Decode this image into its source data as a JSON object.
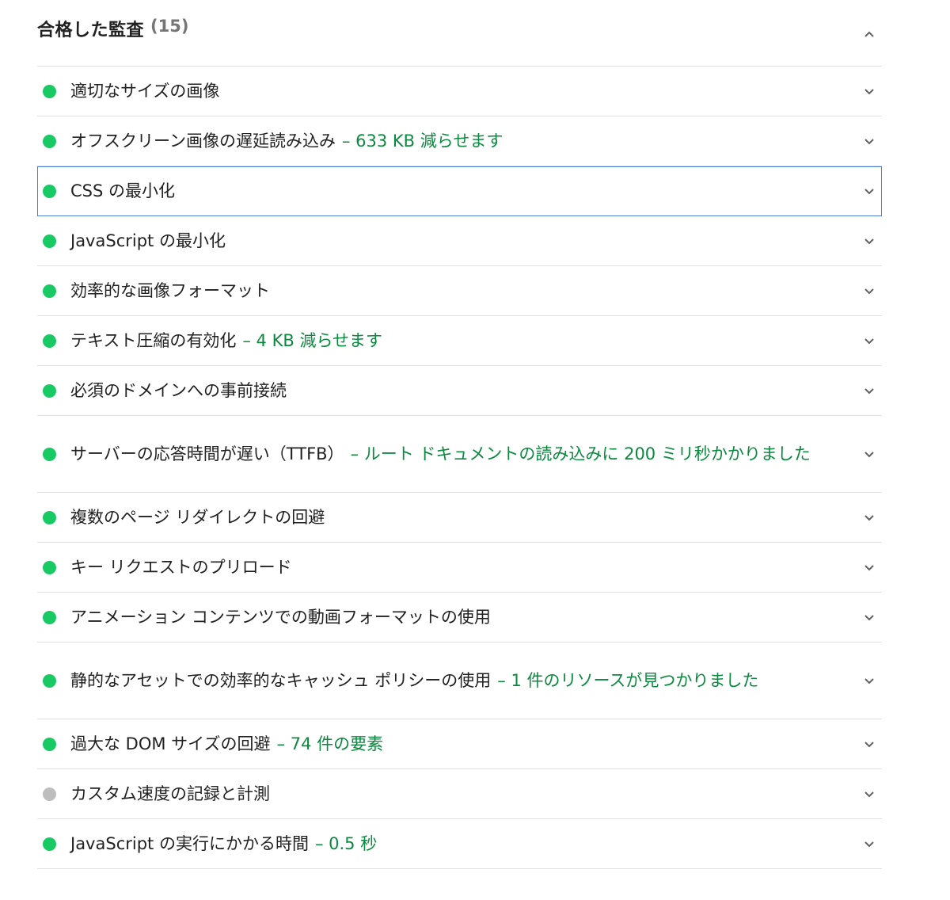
{
  "group": {
    "title": "合格した監査",
    "count": "(15)"
  },
  "colors": {
    "pass": "#18c964",
    "informative": "#bdbdbd",
    "display_value": "#0b8a3f",
    "focus_outline": "#4a7fd4"
  },
  "audits": [
    {
      "title": "適切なサイズの画像",
      "display": "",
      "status": "pass"
    },
    {
      "title": "オフスクリーン画像の遅延読み込み",
      "display": "– 633 KB 減らせます",
      "status": "pass"
    },
    {
      "title": "CSS の最小化",
      "display": "",
      "status": "pass"
    },
    {
      "title": "JavaScript の最小化",
      "display": "",
      "status": "pass"
    },
    {
      "title": "効率的な画像フォーマット",
      "display": "",
      "status": "pass"
    },
    {
      "title": "テキスト圧縮の有効化",
      "display": "– 4 KB 減らせます",
      "status": "pass"
    },
    {
      "title": "必須のドメインへの事前接続",
      "display": "",
      "status": "pass"
    },
    {
      "title": "サーバーの応答時間が遅い（TTFB）",
      "display": "– ルート ドキュメントの読み込みに 200 ミリ秒かかりました",
      "status": "pass"
    },
    {
      "title": "複数のページ リダイレクトの回避",
      "display": "",
      "status": "pass"
    },
    {
      "title": "キー リクエストのプリロード",
      "display": "",
      "status": "pass"
    },
    {
      "title": "アニメーション コンテンツでの動画フォーマットの使用",
      "display": "",
      "status": "pass"
    },
    {
      "title": "静的なアセットでの効率的なキャッシュ ポリシーの使用",
      "display": "– 1 件のリソースが見つかりました",
      "status": "pass"
    },
    {
      "title": "過大な DOM サイズの回避",
      "display": "– 74 件の要素",
      "status": "pass"
    },
    {
      "title": "カスタム速度の記録と計測",
      "display": "",
      "status": "informative"
    },
    {
      "title": "JavaScript の実行にかかる時間",
      "display": "– 0.5 秒",
      "status": "pass"
    }
  ],
  "icons": {
    "expand": "chevron-down-icon",
    "collapse": "chevron-up-icon",
    "status": "status-dot-icon"
  }
}
